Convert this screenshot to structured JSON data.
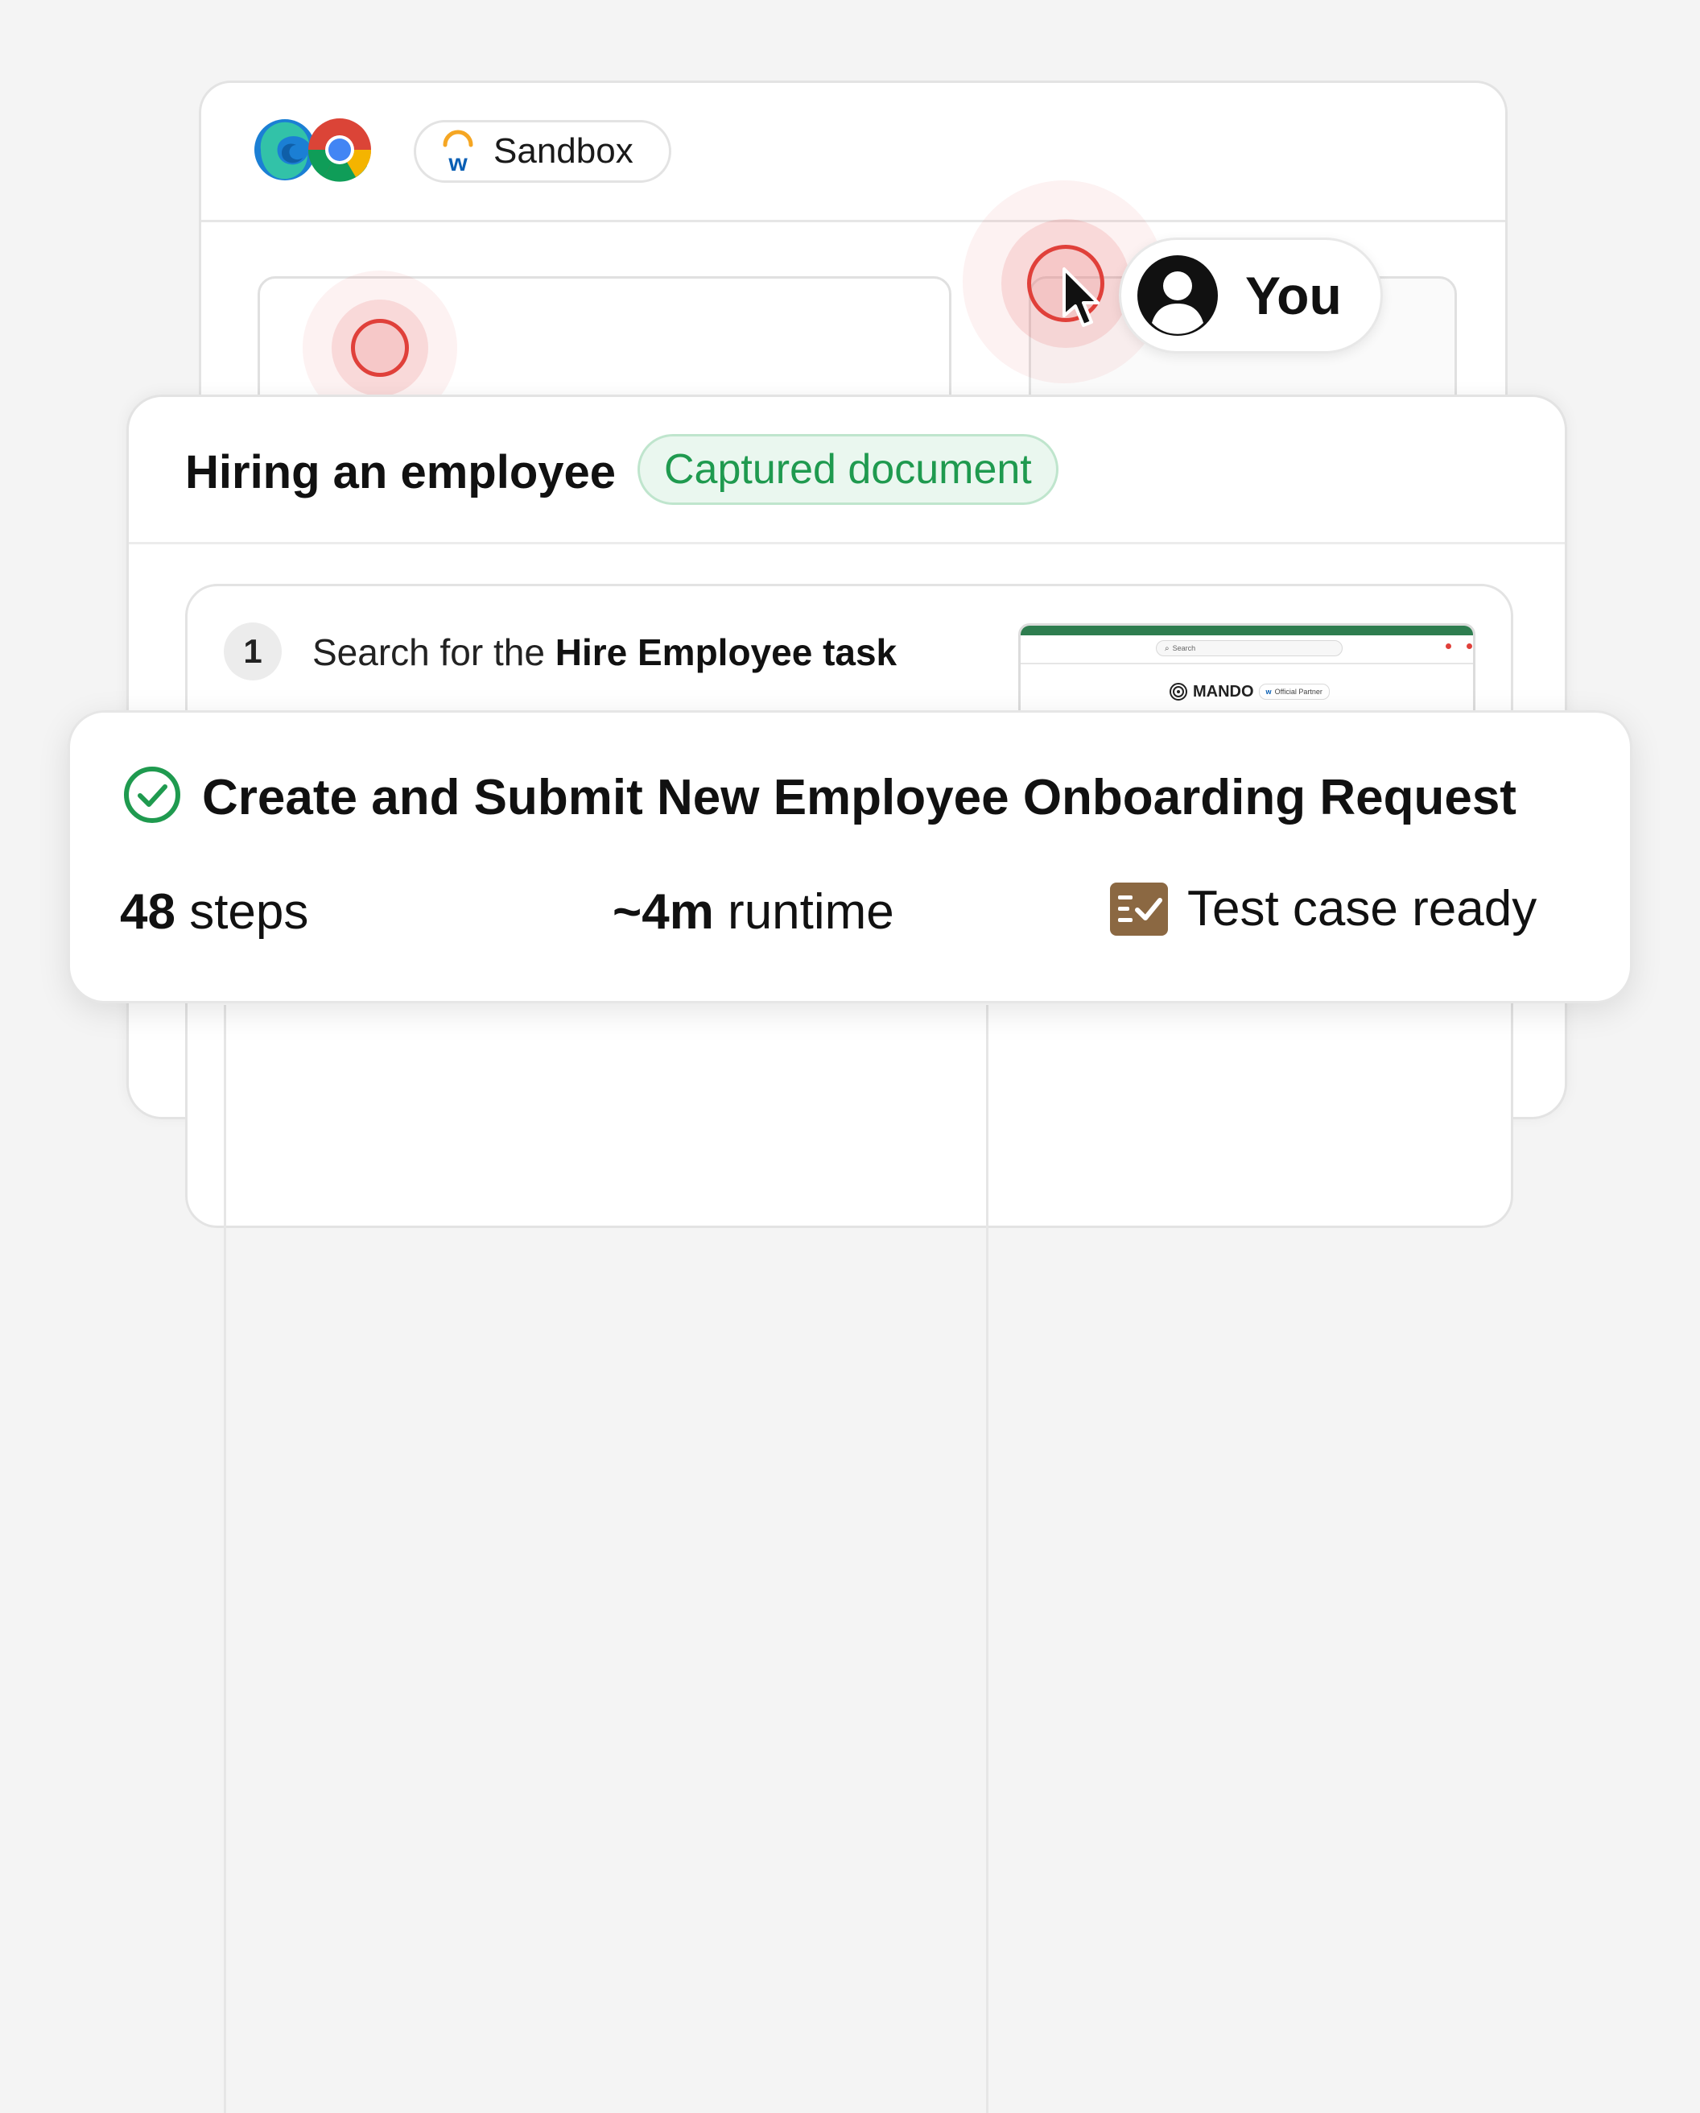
{
  "browser": {
    "logos": [
      "edge-icon",
      "chrome-icon"
    ],
    "environment_label": "Sandbox",
    "environment_icon": "workday-icon"
  },
  "collaborator": {
    "label": "You",
    "icon": "user-avatar-icon"
  },
  "document": {
    "title": "Hiring an employee",
    "badge": "Captured document",
    "badge_color": "#1f9a4f",
    "steps": [
      {
        "number": "1",
        "text_prefix": "Search for the ",
        "text_bold": "Hire Employee task"
      }
    ],
    "thumbnail": {
      "search_placeholder": "Search",
      "brand": "MANDO",
      "partner": "Official Partner"
    }
  },
  "summary": {
    "title": "Create and Submit New Employee Onboarding Request",
    "status_icon": "check-circle-icon",
    "status_color": "#1f9a4f",
    "steps_value": "48",
    "steps_label": " steps",
    "runtime_value": "~4m",
    "runtime_label": " runtime",
    "test_label": "Test case ready",
    "test_icon": "checklist-icon",
    "test_icon_color": "#8b6842"
  },
  "colors": {
    "accent_red": "#e0403a",
    "accent_green": "#1f9a4f"
  }
}
